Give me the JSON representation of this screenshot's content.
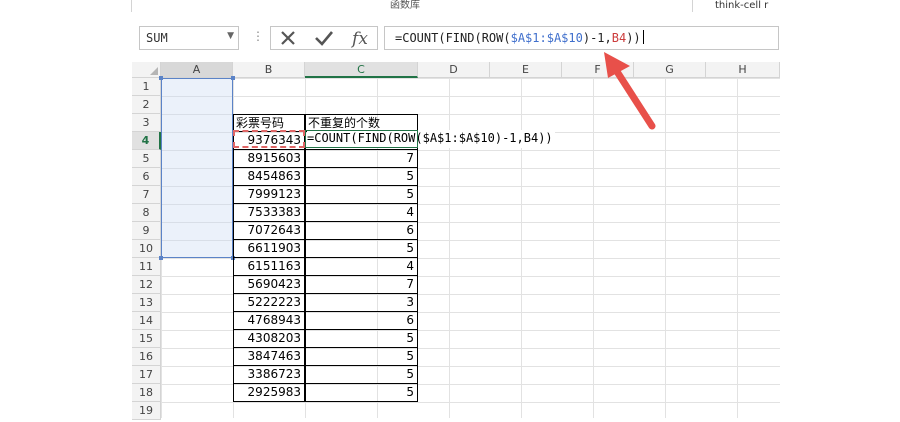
{
  "ribbon": {
    "group_label": "函数库",
    "right_label": "think-cell r"
  },
  "formula_bar": {
    "name_box": "SUM",
    "cancel_icon": "x-icon",
    "confirm_icon": "check-icon",
    "fx_label": "fx",
    "formula_parts": [
      "=COUNT(FIND(ROW(",
      "$A$1:$A$10",
      ")-1,",
      "B4",
      "))"
    ]
  },
  "sheet": {
    "columns": [
      "A",
      "B",
      "C",
      "D",
      "E",
      "F",
      "G",
      "H"
    ],
    "rows": [
      "1",
      "2",
      "3",
      "4",
      "5",
      "6",
      "7",
      "8",
      "9",
      "10",
      "11",
      "12",
      "13",
      "14",
      "15",
      "16",
      "17",
      "18",
      "19"
    ],
    "active_cell": "C4",
    "header_b": "彩票号码",
    "header_c": "不重复的个数",
    "editing_text": "=COUNT(FIND(ROW($A$1:$A$10)-1,B4))",
    "lottery_numbers": [
      "9376343",
      "8915603",
      "8454863",
      "7999123",
      "7533383",
      "7072643",
      "6611903",
      "6151163",
      "5690423",
      "5222223",
      "4768943",
      "4308203",
      "3847463",
      "3386723",
      "2925983"
    ],
    "unique_counts": [
      "",
      "7",
      "5",
      "5",
      "4",
      "6",
      "5",
      "4",
      "7",
      "3",
      "6",
      "5",
      "5",
      "5",
      "5"
    ]
  },
  "colors": {
    "accent_green": "#217346",
    "ref_blue": "#3f6fcc",
    "ref_red": "#cc3b3b",
    "arrow_red": "#e8504a"
  }
}
